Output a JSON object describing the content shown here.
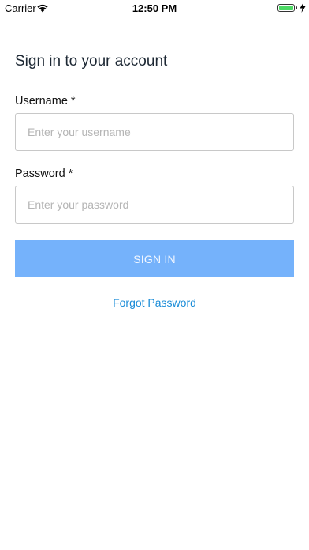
{
  "status_bar": {
    "carrier": "Carrier",
    "time": "12:50 PM",
    "battery_color": "#4cd964"
  },
  "page": {
    "title": "Sign in to your account"
  },
  "form": {
    "username_label": "Username *",
    "username_placeholder": "Enter your username",
    "password_label": "Password *",
    "password_placeholder": "Enter your password",
    "sign_in_label": "SIGN IN",
    "forgot_password_label": "Forgot Password"
  },
  "colors": {
    "button": "#75b2fb",
    "link": "#1a8cd8",
    "title": "#1c2733"
  },
  "icons": {
    "wifi": "wifi-icon",
    "battery": "battery-icon",
    "charging": "charging-bolt-icon"
  }
}
